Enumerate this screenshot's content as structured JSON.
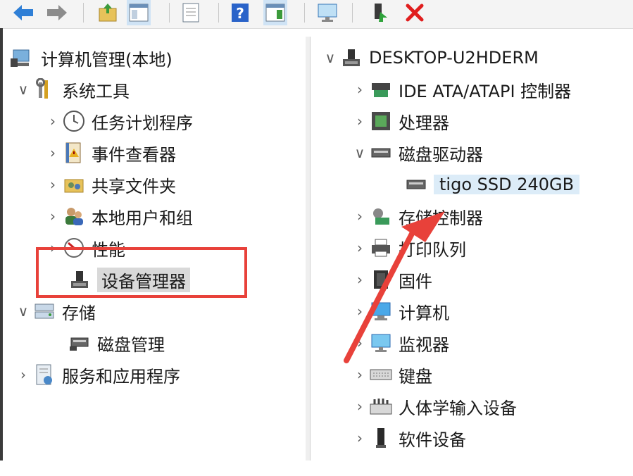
{
  "toolbar": {
    "buttons": [
      "back-arrow-icon",
      "forward-arrow-icon",
      "up-folder-icon",
      "console-tree-icon",
      "properties-icon",
      "help-icon",
      "action-pane-icon",
      "monitor-icon",
      "enable-device-icon",
      "uninstall-device-icon"
    ]
  },
  "left_tree": {
    "root": "计算机管理(本地)",
    "system_tools": "系统工具",
    "task_scheduler": "任务计划程序",
    "event_viewer": "事件查看器",
    "shared_folders": "共享文件夹",
    "local_users": "本地用户和组",
    "performance": "性能",
    "device_manager": "设备管理器",
    "storage": "存储",
    "disk_management": "磁盘管理",
    "services_apps": "服务和应用程序"
  },
  "right_tree": {
    "computer_name": "DESKTOP-U2HDERM",
    "ide": "IDE ATA/ATAPI 控制器",
    "processor": "处理器",
    "disk_drives": "磁盘驱动器",
    "ssd": "tigo SSD 240GB",
    "storage_controllers": "存储控制器",
    "print_queues": "打印队列",
    "firmware": "固件",
    "computer": "计算机",
    "monitors": "监视器",
    "keyboard": "键盘",
    "hid": "人体学输入设备",
    "software_devices": "软件设备"
  },
  "colors": {
    "annotation_red": "#e8413a",
    "selection_blue": "#dcecf8",
    "selection_gray": "#d9d9d9"
  }
}
